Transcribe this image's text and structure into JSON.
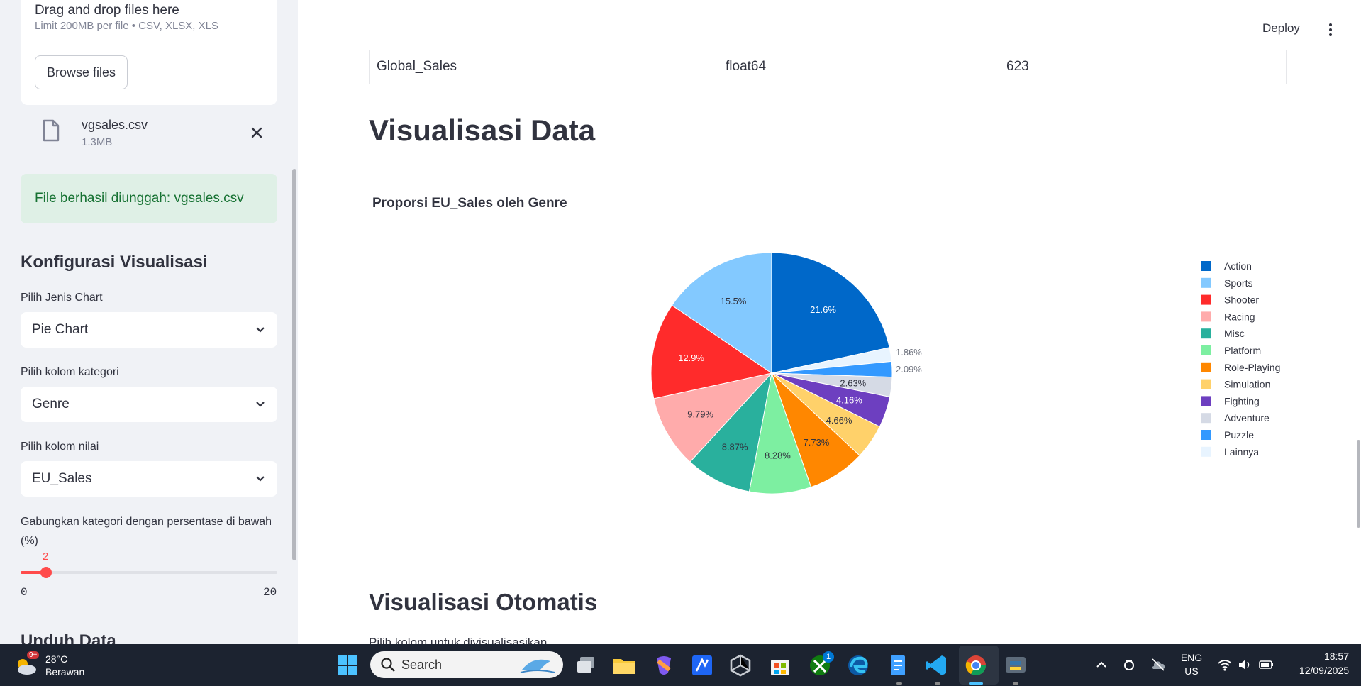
{
  "sidebar": {
    "uploader": {
      "title": "Drag and drop files here",
      "limit": "Limit 200MB per file • CSV, XLSX, XLS",
      "browse_label": "Browse files"
    },
    "file": {
      "name": "vgsales.csv",
      "size": "1.3MB"
    },
    "success": "File berhasil diunggah: vgsales.csv",
    "config_heading": "Konfigurasi Visualisasi",
    "chart_type": {
      "label": "Pilih Jenis Chart",
      "value": "Pie Chart"
    },
    "category_col": {
      "label": "Pilih kolom kategori",
      "value": "Genre"
    },
    "value_col": {
      "label": "Pilih kolom nilai",
      "value": "EU_Sales"
    },
    "slider": {
      "label": "Gabungkan kategori dengan persentase di bawah (%)",
      "value": "2",
      "min": "0",
      "max": "20",
      "fraction": 0.1
    },
    "download_heading": "Unduh Data"
  },
  "header": {
    "deploy": "Deploy"
  },
  "table_row": {
    "column": "Global_Sales",
    "dtype": "float64",
    "count": "623"
  },
  "main": {
    "heading": "Visualisasi Data",
    "heading2": "Visualisasi Otomatis",
    "helper": "Pilih kolom untuk divisualisasikan"
  },
  "chart_data": {
    "type": "pie",
    "title": "Proporsi EU_Sales oleh Genre",
    "categories": [
      "Action",
      "Sports",
      "Shooter",
      "Racing",
      "Misc",
      "Platform",
      "Role-Playing",
      "Simulation",
      "Fighting",
      "Adventure",
      "Puzzle",
      "Lainnya"
    ],
    "values": [
      21.6,
      15.5,
      12.9,
      9.79,
      8.87,
      8.28,
      7.73,
      4.66,
      4.16,
      2.63,
      2.09,
      1.86
    ],
    "labels": [
      "21.6%",
      "15.5%",
      "12.9%",
      "9.79%",
      "8.87%",
      "8.28%",
      "7.73%",
      "4.66%",
      "4.16%",
      "2.63%",
      "2.09%",
      "1.86%"
    ],
    "colors": [
      "#0068c9",
      "#83c9ff",
      "#ff2b2b",
      "#ffabab",
      "#29b09d",
      "#7defa1",
      "#ff8700",
      "#ffd16a",
      "#6d3fc0",
      "#d5dae5",
      "#3399ff",
      "#e8f4ff"
    ],
    "slice_order": [
      "Action",
      "Lainnya",
      "Puzzle",
      "Adventure",
      "Fighting",
      "Simulation",
      "Role-Playing",
      "Platform",
      "Misc",
      "Racing",
      "Shooter",
      "Sports"
    ],
    "legend_position": "right"
  },
  "taskbar": {
    "weather_temp": "28°C",
    "weather_cond": "Berawan",
    "weather_badge": "9+",
    "search_placeholder": "Search",
    "lang": "ENG",
    "region": "US",
    "time": "18:57",
    "date": "12/09/2025",
    "edge_badge": "1"
  }
}
